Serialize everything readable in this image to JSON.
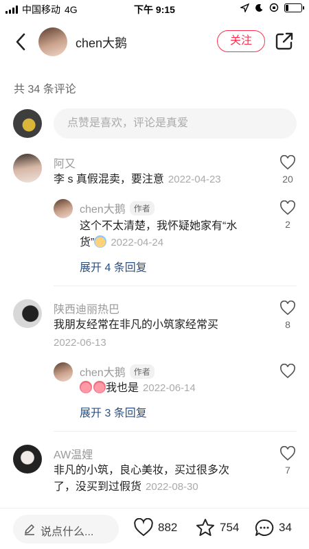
{
  "status_bar": {
    "carrier": "中国移动",
    "network": "4G",
    "time": "下午 9:15",
    "battery_level": 0.2
  },
  "header": {
    "back_icon": "chevron-left-icon",
    "username": "chen大鹅",
    "follow_label": "关注",
    "share_icon": "share-icon",
    "accent_color": "#ff2e4d"
  },
  "comment_count_text": "共 34 条评论",
  "input": {
    "placeholder": "点赞是喜欢，评论是真爱"
  },
  "comments": [
    {
      "author": "阿又",
      "text": "李 s 真假混卖，要注意",
      "date": "2022-04-23",
      "likes": "20",
      "replies": [
        {
          "author": "chen大鹅",
          "badge": "作者",
          "text_line1": "这个不太清楚，我怀疑她家有“水",
          "text_line2": "货”",
          "date": "2022-04-24",
          "likes": "2"
        }
      ],
      "expand_label": "展开 4 条回复"
    },
    {
      "author": "陕西迪丽热巴",
      "text": "我朋友经常在非凡的小筑家经常买",
      "date": "2022-06-13",
      "likes": "8",
      "replies": [
        {
          "author": "chen大鹅",
          "badge": "作者",
          "text": "我也是",
          "date": "2022-06-14"
        }
      ],
      "expand_label": "展开 3 条回复"
    },
    {
      "author": "AW温娌",
      "text_line1": "非凡的小筑，良心美妆，买过很多次",
      "text_line2": "了，没买到过假货",
      "date": "2022-08-30",
      "likes": "7"
    }
  ],
  "bottom_bar": {
    "say_label": "说点什么...",
    "like_count": "882",
    "star_count": "754",
    "comment_count": "34"
  }
}
